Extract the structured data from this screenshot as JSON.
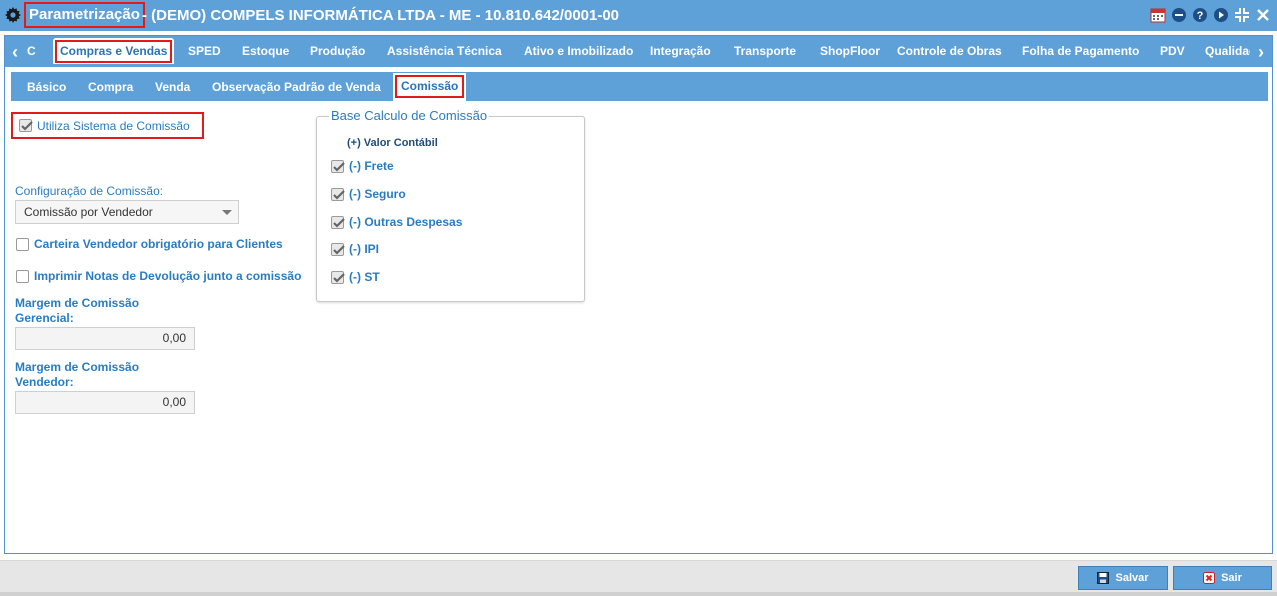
{
  "titlebar": {
    "app_name": "Parametrização",
    "company": "- (DEMO) COMPELS INFORMÁTICA LTDA - ME - 10.810.642/0001-00",
    "icons": [
      "calendar-icon",
      "minimize-icon",
      "help-icon",
      "play-icon",
      "restore-icon",
      "close-icon"
    ]
  },
  "main_tabs": {
    "left_arrow": "‹",
    "right_arrow": "›",
    "items": [
      "C",
      "Compras e Vendas",
      "SPED",
      "Estoque",
      "Produção",
      "Assistência Técnica",
      "Ativo e Imobilizado",
      "Integração",
      "Transporte",
      "ShopFloor",
      "Controle de Obras",
      "Folha de Pagamento",
      "PDV",
      "Qualidad"
    ],
    "active": "Compras e Vendas"
  },
  "sub_tabs": {
    "items": [
      "Básico",
      "Compra",
      "Venda",
      "Observação Padrão de Venda",
      "Comissão"
    ],
    "active": "Comissão"
  },
  "form": {
    "utiliza_label": "Utiliza Sistema de Comissão",
    "utiliza_checked": true,
    "config_label": "Configuração de Comissão:",
    "config_value": "Comissão por Vendedor",
    "carteira_label": "Carteira Vendedor obrigatório para Clientes",
    "carteira_checked": false,
    "imprimir_label": "Imprimir Notas de Devolução junto a comissão",
    "imprimir_checked": false,
    "margem_gerencial_label_1": "Margem de Comissão",
    "margem_gerencial_label_2": "Gerencial:",
    "margem_gerencial_value": "0,00",
    "margem_vendedor_label_1": "Margem de Comissão",
    "margem_vendedor_label_2": "Vendedor:",
    "margem_vendedor_value": "0,00"
  },
  "base_calculo": {
    "legend": "Base Calculo de Comissão",
    "valor_contabil": "(+) Valor Contábil",
    "items": [
      {
        "label": "(-) Frete",
        "checked": true
      },
      {
        "label": "(-) Seguro",
        "checked": true
      },
      {
        "label": "(-) Outras Despesas",
        "checked": true
      },
      {
        "label": "(-) IPI",
        "checked": true
      },
      {
        "label": "(-) ST",
        "checked": true
      }
    ]
  },
  "footer": {
    "save_label": "Salvar",
    "exit_label": "Sair"
  },
  "colors": {
    "accent": "#5ea0d8",
    "label_blue": "#2a7cc0",
    "highlight_red": "#e21a1a"
  }
}
